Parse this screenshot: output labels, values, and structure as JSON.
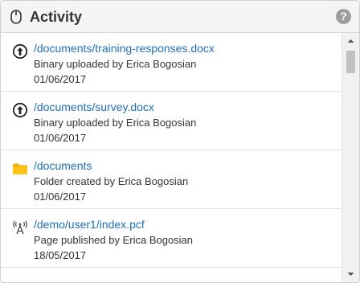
{
  "header": {
    "title": "Activity",
    "help_glyph": "?",
    "icon": "mouse-icon"
  },
  "items": [
    {
      "icon": "upload-circle-icon",
      "path": "/documents/training-responses.docx",
      "description": "Binary uploaded by Erica Bogosian",
      "date": "01/06/2017"
    },
    {
      "icon": "upload-circle-icon",
      "path": "/documents/survey.docx",
      "description": "Binary uploaded by Erica Bogosian",
      "date": "01/06/2017"
    },
    {
      "icon": "folder-icon",
      "path": "/documents",
      "description": "Folder created by Erica Bogosian",
      "date": "01/06/2017"
    },
    {
      "icon": "broadcast-icon",
      "path": "/demo/user1/index.pcf",
      "description": "Page published by Erica Bogosian",
      "date": "18/05/2017"
    }
  ],
  "colors": {
    "link": "#1f6fb5",
    "folder": "#f5b400",
    "header_bg": "#f5f5f5"
  }
}
